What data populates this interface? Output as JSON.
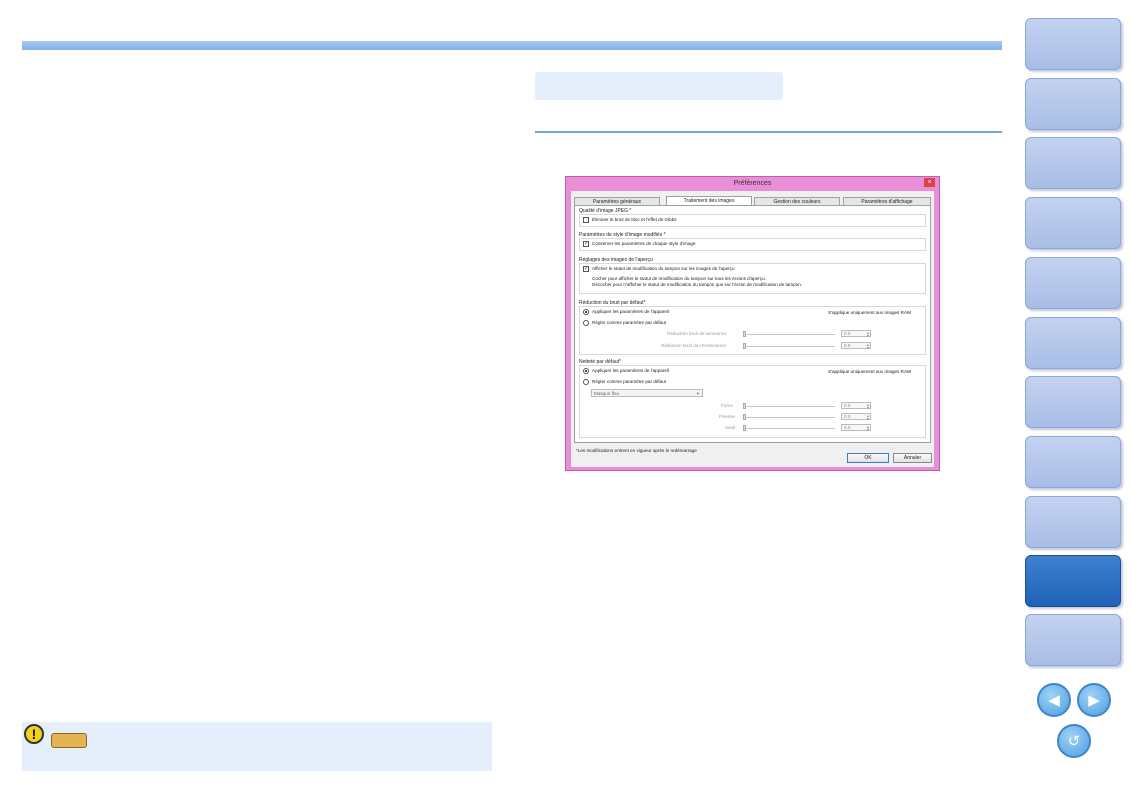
{
  "dialog": {
    "title": "Préférences",
    "close_glyph": "×",
    "tabs": [
      "Paramètres généraux",
      "Traitement des images",
      "Gestion des couleurs",
      "Paramètres d'affichage"
    ],
    "groups": {
      "jpeg": {
        "title": "Qualité d'image JPEG *",
        "checkbox": "Éliminer le bruit de bloc et l'effet de Gibbs"
      },
      "style": {
        "title": "Paramètres de style d'image modifiés *",
        "checkbox": "Conserver les paramètres de chaque style d'image"
      },
      "preview": {
        "title": "Réglages des images de l'aperçu",
        "checkbox": "Afficher le statut de modification du tampon sur les images de l'aperçu",
        "note1": "Cocher pour afficher le statut de modification du tampon sur tous les écrans d'aperçu.",
        "note2": "Décocher pour n'afficher le statut de modification du tampon que sur l'écran de modification de tampon."
      },
      "noise": {
        "title": "Réduction du bruit par défaut*",
        "radio1": "Appliquer les paramètres de l'appareil",
        "radio2": "Régler comme paramètre par défaut",
        "raw_note": "S'applique uniquement aux images RAW",
        "slider1_label": "Réduction bruit de luminance",
        "slider1_value": "0.0",
        "slider2_label": "Réduction bruit de chrominance",
        "slider2_value": "0.0"
      },
      "sharpness": {
        "title": "Netteté par défaut*",
        "radio1": "Appliquer les paramètres de l'appareil",
        "radio2": "Régler comme paramètre par défaut",
        "raw_note": "S'applique uniquement aux images RAW",
        "combo": "Masque flou",
        "slider1_label": "Force",
        "slider1_value": "0.0",
        "slider2_label": "Finesse",
        "slider2_value": "0.0",
        "slider3_label": "Seuil",
        "slider3_value": "0.0"
      }
    },
    "footer_note": "*Les modifications entrent en vigueur après le redémarrage",
    "ok_label": "OK",
    "cancel_label": "Annuler"
  },
  "warning_icon_glyph": "!",
  "nav": {
    "prev_glyph": "◀",
    "next_glyph": "▶",
    "return_glyph": "↺"
  },
  "colors": {
    "accent": "#7fb0ea",
    "nav_active": "#1f62b8",
    "dialog_frame": "#e98ed7"
  }
}
